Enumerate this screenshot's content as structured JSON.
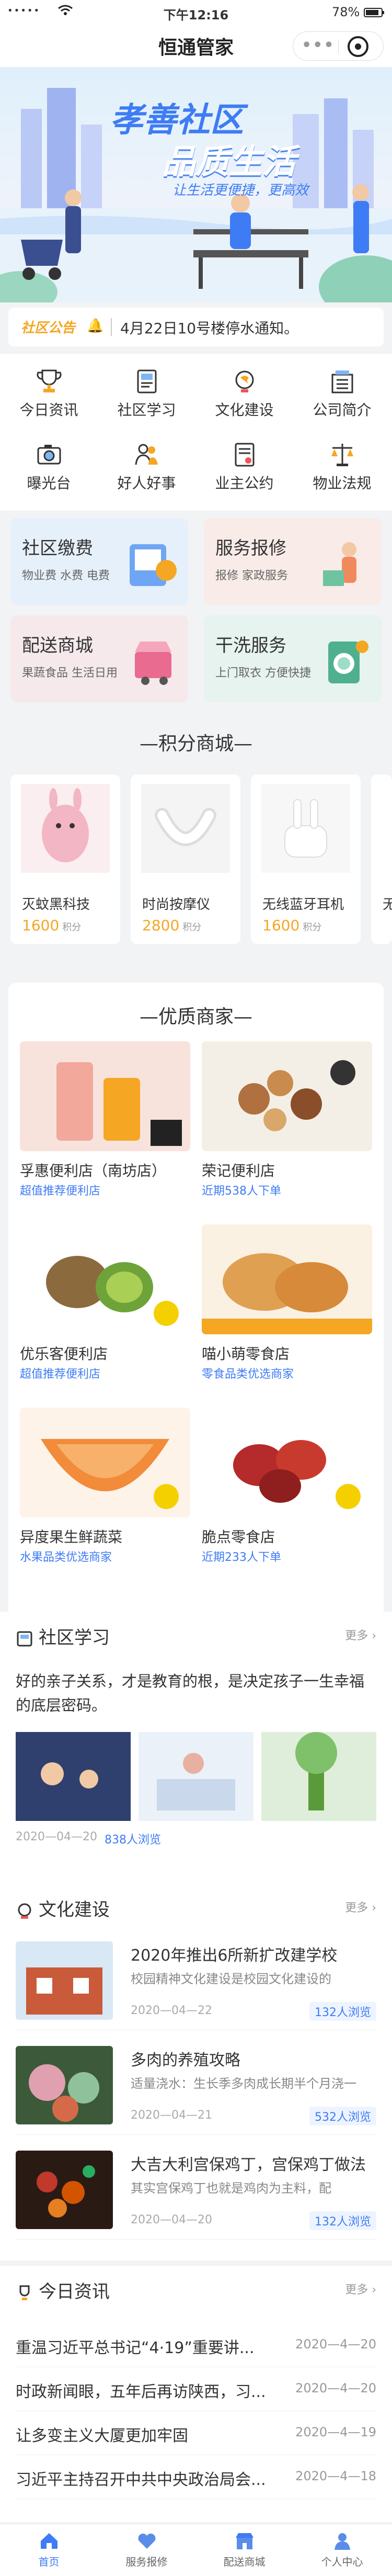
{
  "status_bar": {
    "signal": "•••••",
    "time": "下午12:16",
    "battery": "78%"
  },
  "nav": {
    "title": "恒通管家",
    "more_glyph": "•••"
  },
  "banner": {
    "title_line1": "孝善社区",
    "title_line2": "品质生活",
    "slogan": "让生活更便捷，更高效"
  },
  "notice": {
    "tag": "社区公告",
    "text": "4月22日10号楼停水通知。"
  },
  "grid": [
    {
      "label": "今日资讯",
      "icon": "trophy-icon"
    },
    {
      "label": "社区学习",
      "icon": "book-icon"
    },
    {
      "label": "文化建设",
      "icon": "globe-icon"
    },
    {
      "label": "公司简介",
      "icon": "office-icon"
    },
    {
      "label": "曝光台",
      "icon": "camera-icon"
    },
    {
      "label": "好人好事",
      "icon": "people-icon"
    },
    {
      "label": "业主公约",
      "icon": "contract-icon"
    },
    {
      "label": "物业法规",
      "icon": "scales-icon"
    }
  ],
  "services": [
    {
      "title": "社区缴费",
      "sub": "物业费 水费 电费",
      "bg": "#e6f0fb"
    },
    {
      "title": "服务报修",
      "sub": "报修 家政服务",
      "bg": "#f9ebe8"
    },
    {
      "title": "配送商城",
      "sub": "果蔬食品 生活日用",
      "bg": "#f5e9ec"
    },
    {
      "title": "干洗服务",
      "sub": "上门取衣 方便快捷",
      "bg": "#e6f3ef"
    }
  ],
  "points_mall": {
    "title": "—积分商城—",
    "unit": "积分",
    "items": [
      {
        "name": "灭蚊黑科技",
        "points": "1600"
      },
      {
        "name": "时尚按摩仪",
        "points": "2800"
      },
      {
        "name": "无线蓝牙耳机",
        "points": "1600"
      },
      {
        "name": "无线",
        "points": ""
      }
    ]
  },
  "merchants": {
    "title": "—优质商家—",
    "items": [
      {
        "name": "孚惠便利店（南坊店）",
        "sub": "超值推荐便利店"
      },
      {
        "name": "荣记便利店",
        "sub": "近期538人下单"
      },
      {
        "name": "优乐客便利店",
        "sub": "超值推荐便利店"
      },
      {
        "name": "喵小萌零食店",
        "sub": "零食品类优选商家"
      },
      {
        "name": "异度果生鲜蔬菜",
        "sub": "水果品类优选商家"
      },
      {
        "name": "脆点零食店",
        "sub": "近期233人下单"
      }
    ]
  },
  "study": {
    "title": "社区学习",
    "more": "更多 ›",
    "quote": "好的亲子关系，才是教育的根，是决定孩子一生幸福的底层密码。",
    "date": "2020—04—20",
    "views": "838人浏览"
  },
  "culture": {
    "title": "文化建设",
    "more": "更多 ›",
    "articles": [
      {
        "title": "2020年推出6所新扩改建学校",
        "summary": "校园精神文化建设是校园文化建设的",
        "date": "2020—04—22",
        "views": "132人浏览"
      },
      {
        "title": "多肉的养殖攻略",
        "summary": "适量浇水：生长季多肉成长期半个月浇一",
        "date": "2020—04—21",
        "views": "532人浏览"
      },
      {
        "title": "大吉大利宫保鸡丁，宫保鸡丁做法",
        "summary": "其实宫保鸡丁也就是鸡肉为主料，配",
        "date": "2020—04—20",
        "views": "132人浏览"
      }
    ]
  },
  "news": {
    "title": "今日资讯",
    "more": "更多 ›",
    "items": [
      {
        "title": "重温习近平总书记“4·19”重要讲...",
        "date": "2020—4—20"
      },
      {
        "title": "时政新闻眼，五年后再访陕西，习...",
        "date": "2020—4—20"
      },
      {
        "title": "让多变主义大厦更加牢固",
        "date": "2020—4—19"
      },
      {
        "title": "习近平主持召开中共中央政治局会...",
        "date": "2020—4—18"
      }
    ]
  },
  "tabbar": [
    {
      "label": "首页",
      "icon": "home-icon"
    },
    {
      "label": "服务报修",
      "icon": "heart-icon"
    },
    {
      "label": "配送商城",
      "icon": "shop-icon"
    },
    {
      "label": "个人中心",
      "icon": "user-icon"
    }
  ],
  "colors": {
    "accent": "#3e7cf5",
    "points": "#f5a623"
  }
}
